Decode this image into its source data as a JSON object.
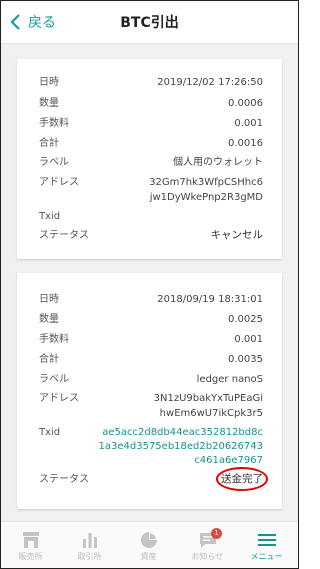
{
  "header": {
    "back_label": "戻る",
    "title": "BTC引出"
  },
  "withdrawals": [
    {
      "labels": {
        "datetime": "日時",
        "amount": "数量",
        "fee": "手数料",
        "total": "合計",
        "label": "ラベル",
        "address": "アドレス",
        "txid": "Txid",
        "status": "ステータス"
      },
      "datetime": "2019/12/02 17:26:50",
      "amount": "0.0006",
      "fee": "0.001",
      "total": "0.0016",
      "label": "個人用のウォレット",
      "address_line1": "32Gm7hk3WfpCSHhc6",
      "address_line2": "jw1DyWkePnp2R3gMD",
      "status": "キャンセル"
    },
    {
      "labels": {
        "datetime": "日時",
        "amount": "数量",
        "fee": "手数料",
        "total": "合計",
        "label": "ラベル",
        "address": "アドレス",
        "txid": "Txid",
        "status": "ステータス"
      },
      "datetime": "2018/09/19 18:31:01",
      "amount": "0.0025",
      "fee": "0.001",
      "total": "0.0035",
      "label": "ledger nanoS",
      "address_line1": "3N1zU9bakYxTuPEaGi",
      "address_line2": "hwEm6wU7ikCpk3r5",
      "txid_line1": "ae5acc2d8db44eac352812bd8c",
      "txid_line2": "1a3e4d3575eb18ed2b20626743",
      "txid_line3": "c461a6e7967",
      "status": "送金完了"
    }
  ],
  "tabbar": {
    "items": [
      {
        "label": "販売所",
        "icon": "shop-icon"
      },
      {
        "label": "取引所",
        "icon": "bar-chart-icon"
      },
      {
        "label": "資産",
        "icon": "pie-chart-icon"
      },
      {
        "label": "お知らせ",
        "icon": "message-icon",
        "badge": "1"
      },
      {
        "label": "メニュー",
        "icon": "menu-icon"
      }
    ]
  },
  "colors": {
    "accent": "#17938e",
    "badge": "#e0473a",
    "highlight_circle": "#e00000"
  }
}
